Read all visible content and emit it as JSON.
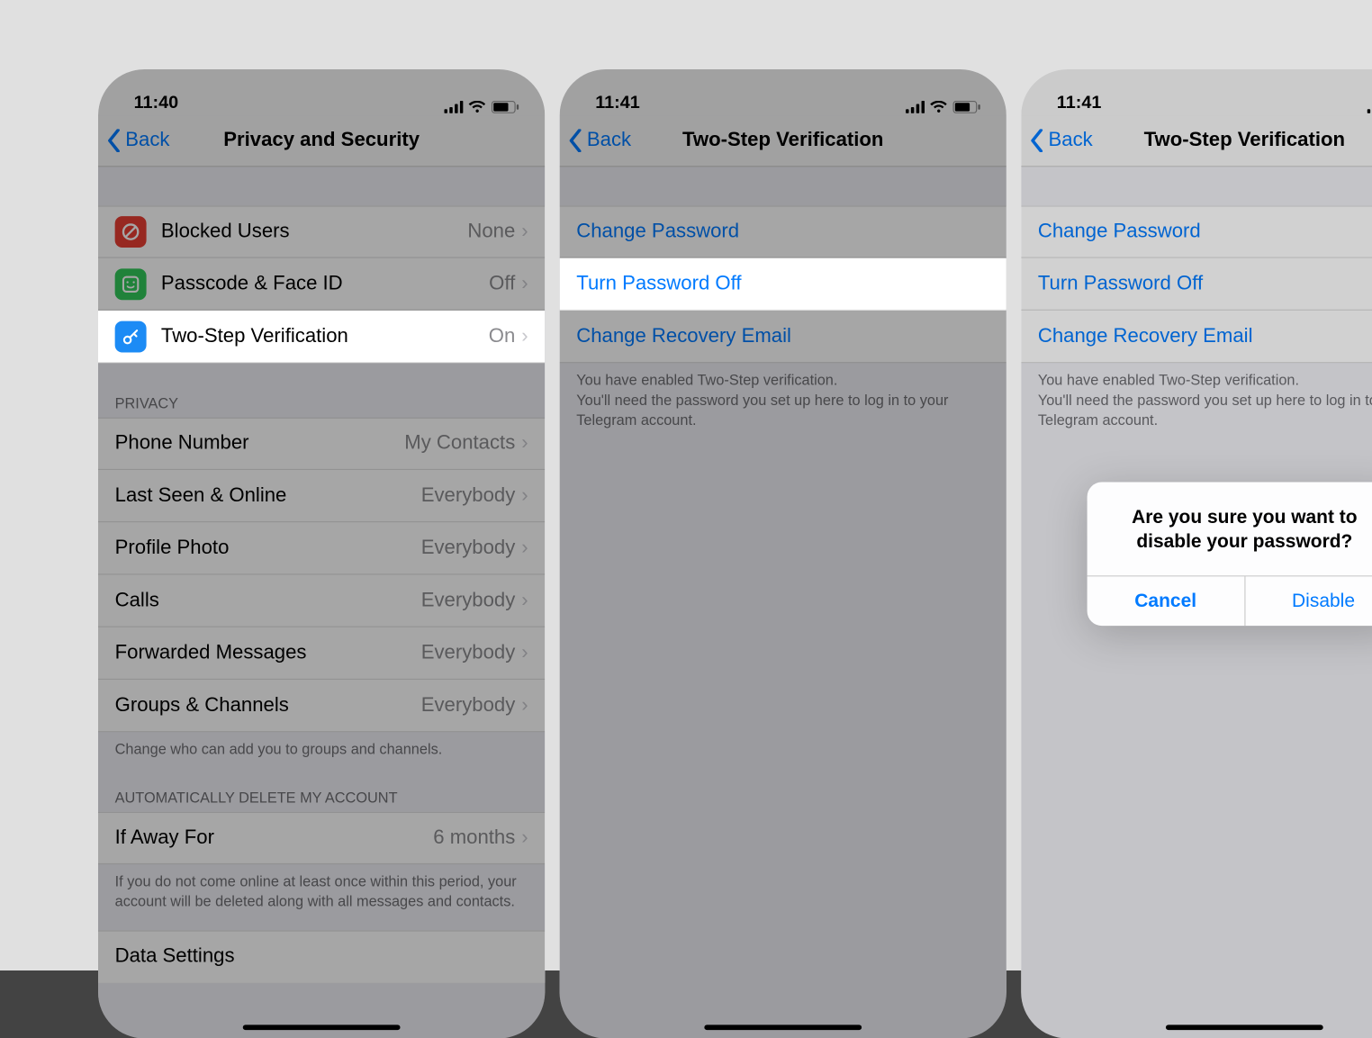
{
  "colors": {
    "ios_blue": "#007aff",
    "icon_red": "#e83e33",
    "icon_green": "#32c85a",
    "icon_blue": "#1c8bf5"
  },
  "screen1": {
    "time": "11:40",
    "back": "Back",
    "title": "Privacy and Security",
    "rows_security": [
      {
        "label": "Blocked Users",
        "value": "None",
        "icon": "blocked"
      },
      {
        "label": "Passcode & Face ID",
        "value": "Off",
        "icon": "passcode"
      },
      {
        "label": "Two-Step Verification",
        "value": "On",
        "icon": "key"
      }
    ],
    "privacy_header": "PRIVACY",
    "rows_privacy": [
      {
        "label": "Phone Number",
        "value": "My Contacts"
      },
      {
        "label": "Last Seen & Online",
        "value": "Everybody"
      },
      {
        "label": "Profile Photo",
        "value": "Everybody"
      },
      {
        "label": "Calls",
        "value": "Everybody"
      },
      {
        "label": "Forwarded Messages",
        "value": "Everybody"
      },
      {
        "label": "Groups & Channels",
        "value": "Everybody"
      }
    ],
    "privacy_footer": "Change who can add you to groups and channels.",
    "auto_delete_header": "AUTOMATICALLY DELETE MY ACCOUNT",
    "away_label": "If Away For",
    "away_value": "6 months",
    "auto_delete_footer": "If you do not come online at least once within this period, your account will be deleted along with all messages and contacts.",
    "data_settings": "Data Settings"
  },
  "screen2": {
    "time": "11:41",
    "back": "Back",
    "title": "Two-Step Verification",
    "rows": [
      {
        "label": "Change Password"
      },
      {
        "label": "Turn Password Off"
      },
      {
        "label": "Change Recovery Email"
      }
    ],
    "footer": "You have enabled Two-Step verification.\nYou'll need the password you set up here to log in to your Telegram account."
  },
  "screen3": {
    "time": "11:41",
    "back": "Back",
    "title": "Two-Step Verification",
    "rows": [
      {
        "label": "Change Password"
      },
      {
        "label": "Turn Password Off"
      },
      {
        "label": "Change Recovery Email"
      }
    ],
    "footer": "You have enabled Two-Step verification.\nYou'll need the password you set up here to log in to your Telegram account.",
    "alert": {
      "message": "Are you sure you want to disable your password?",
      "cancel": "Cancel",
      "confirm": "Disable"
    }
  }
}
